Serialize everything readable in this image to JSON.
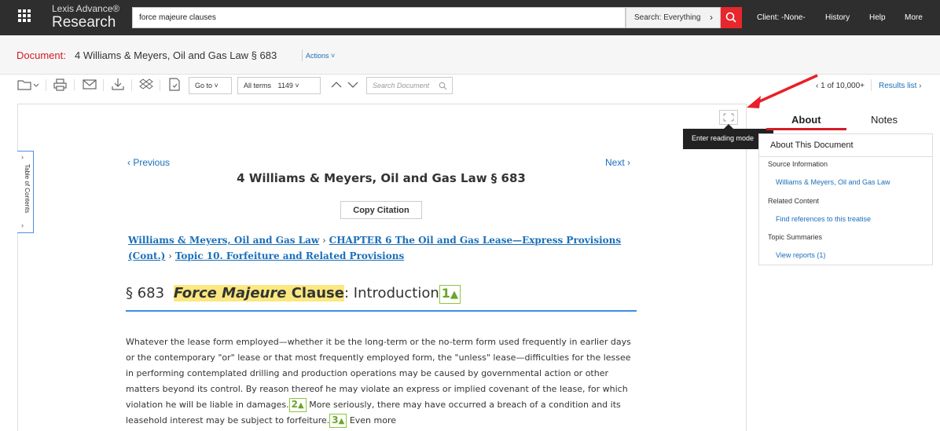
{
  "header": {
    "brand_small": "Lexis Advance®",
    "brand_large": "Research",
    "search_value": "force majeure clauses",
    "search_scope": "Search: Everything",
    "nav": [
      "Client: -None-",
      "History",
      "Help",
      "More"
    ]
  },
  "document": {
    "label": "Document:",
    "title": "4 Williams & Meyers, Oil and Gas Law § 683",
    "actions": "Actions"
  },
  "toolbar": {
    "goto": "Go to",
    "terms_label": "All terms",
    "terms_count": "1149",
    "search_doc_placeholder": "Search Document",
    "pager": "1 of 10,000+",
    "results_list": "Results list"
  },
  "toc_label": "Table of Contents",
  "reading_mode_tooltip": "Enter reading mode",
  "content": {
    "prev": "Previous",
    "next": "Next",
    "title": "4 Williams & Meyers, Oil and Gas Law § 683",
    "copy_citation": "Copy Citation",
    "breadcrumb": [
      "Williams & Meyers, Oil and Gas Law",
      "CHAPTER 6 The Oil and Gas Lease—Express Provisions (Cont.)",
      "Topic 10. Forfeiture and Related Provisions"
    ],
    "heading_section": "§ 683",
    "heading_highlight_1": "Force Majeure",
    "heading_highlight_2": "Clause",
    "heading_rest": ": Introduction",
    "fn1": "1",
    "para_part1": "Whatever the lease form employed—whether it be the long-term or the no-term form used frequently in earlier days or the contemporary \"or\" lease or that most frequently employed form, the \"unless\" lease—difficulties for the lessee in performing contemplated drilling and production operations may be caused by governmental action or other matters beyond its control. By reason thereof he may violate an express or implied covenant of the lease, for which violation he will be liable in damages.",
    "fn2": "2",
    "para_part2": "More seriously, there may have occurred a breach of a condition and its leasehold interest may be subject to forfeiture.",
    "fn3": "3",
    "para_part3": "Even more"
  },
  "sidebar": {
    "tab_about": "About",
    "tab_notes": "Notes",
    "heading": "About This Document",
    "source_label": "Source Information",
    "source_link": "Williams & Meyers, Oil and Gas Law",
    "related_label": "Related Content",
    "related_link": "Find references to this treatise",
    "topic_label": "Topic Summaries",
    "topic_link": "View reports (1)"
  },
  "colors": {
    "accent_red": "#d21c26",
    "link_blue": "#1a6fb9",
    "highlight_yellow": "#fbe880",
    "footnote_green": "#8dc63f"
  }
}
